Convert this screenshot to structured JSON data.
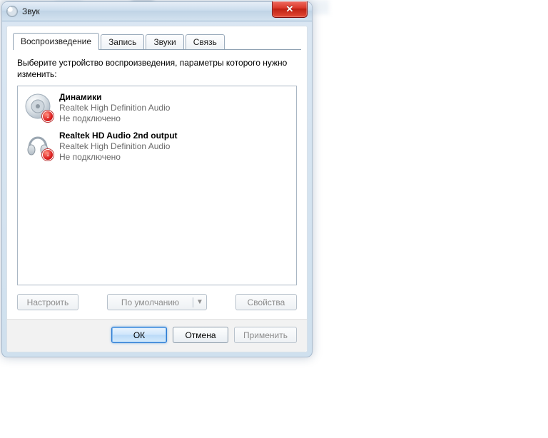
{
  "window": {
    "title": "Звук"
  },
  "tabs": [
    {
      "label": "Воспроизведение",
      "active": true
    },
    {
      "label": "Запись",
      "active": false
    },
    {
      "label": "Звуки",
      "active": false
    },
    {
      "label": "Связь",
      "active": false
    }
  ],
  "playback": {
    "instruction": "Выберите устройство воспроизведения, параметры которого нужно изменить:",
    "devices": [
      {
        "name": "Динамики",
        "driver": "Realtek High Definition Audio",
        "status": "Не подключено",
        "icon": "speaker"
      },
      {
        "name": "Realtek HD Audio 2nd output",
        "driver": "Realtek High Definition Audio",
        "status": "Не подключено",
        "icon": "headphones"
      }
    ],
    "buttons": {
      "configure": "Настроить",
      "default": "По умолчанию",
      "properties": "Свойства"
    }
  },
  "commit": {
    "ok": "ОК",
    "cancel": "Отмена",
    "apply": "Применить"
  }
}
